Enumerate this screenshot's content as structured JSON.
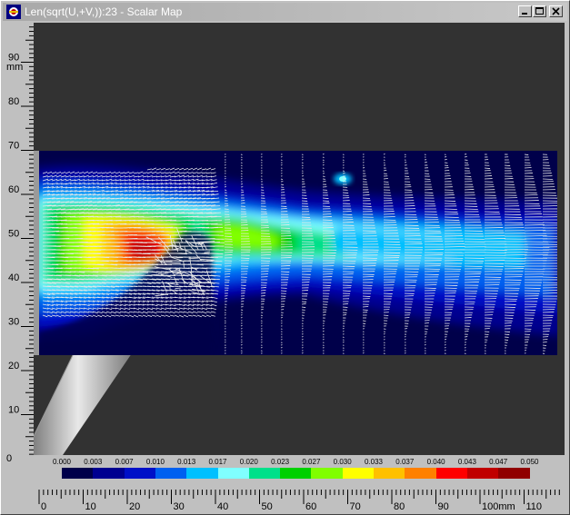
{
  "window": {
    "title": "Len(sqrt(U,+V,)):23 - Scalar Map"
  },
  "left_ruler": {
    "unit": "mm",
    "ticks": [
      "90",
      "80",
      "70",
      "60",
      "50",
      "40",
      "30",
      "20",
      "10",
      "0"
    ]
  },
  "bottom_ruler": {
    "unit": "mm",
    "ticks": [
      "0",
      "10",
      "20",
      "30",
      "40",
      "50",
      "60",
      "70",
      "80",
      "90",
      "100",
      "110"
    ]
  },
  "colorbar": {
    "labels": [
      "0.000",
      "0.003",
      "0.007",
      "0.010",
      "0.013",
      "0.017",
      "0.020",
      "0.023",
      "0.027",
      "0.030",
      "0.033",
      "0.037",
      "0.040",
      "0.043",
      "0.047",
      "0.050"
    ],
    "colors": [
      "#00004a",
      "#000090",
      "#0010c8",
      "#0060f0",
      "#00c0ff",
      "#80ffff",
      "#00e08a",
      "#00d000",
      "#80ff00",
      "#ffff00",
      "#ffc000",
      "#ff8000",
      "#ff0000",
      "#c00000",
      "#900000"
    ]
  },
  "scalar_map": {
    "quantity": "Len(sqrt(U,+V,))",
    "frame": "23"
  }
}
